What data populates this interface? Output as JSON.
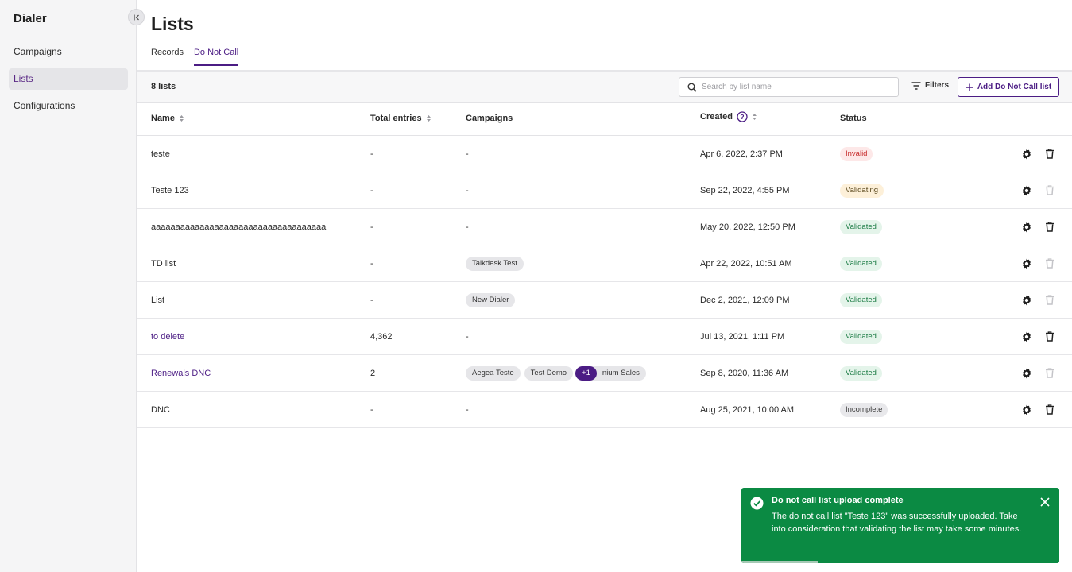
{
  "app": {
    "title": "Dialer"
  },
  "sidebar": {
    "items": [
      {
        "label": "Campaigns",
        "active": false
      },
      {
        "label": "Lists",
        "active": true
      },
      {
        "label": "Configurations",
        "active": false
      }
    ]
  },
  "page": {
    "title": "Lists"
  },
  "tabs": [
    {
      "label": "Records",
      "active": false
    },
    {
      "label": "Do Not Call",
      "active": true
    }
  ],
  "toolbar": {
    "count": "8 lists",
    "search_placeholder": "Search by list name",
    "filters_label": "Filters",
    "add_label": "Add Do Not Call list"
  },
  "table": {
    "headers": {
      "name": "Name",
      "total": "Total entries",
      "campaigns": "Campaigns",
      "created": "Created",
      "status": "Status"
    },
    "rows": [
      {
        "name": "teste",
        "link": false,
        "total": "-",
        "campaigns": [],
        "campaigns_text": "-",
        "created": "Apr 6, 2022, 2:37 PM",
        "status": "Invalid",
        "delete_enabled": true
      },
      {
        "name": "Teste 123",
        "link": false,
        "total": "-",
        "campaigns": [],
        "campaigns_text": "-",
        "created": "Sep 22, 2022, 4:55 PM",
        "status": "Validating",
        "delete_enabled": false
      },
      {
        "name": "aaaaaaaaaaaaaaaaaaaaaaaaaaaaaaaaaaaa",
        "link": false,
        "total": "-",
        "campaigns": [],
        "campaigns_text": "-",
        "created": "May 20, 2022, 12:50 PM",
        "status": "Validated",
        "delete_enabled": true
      },
      {
        "name": "TD list",
        "link": false,
        "total": "-",
        "campaigns": [
          "Talkdesk Test"
        ],
        "campaigns_text": "",
        "created": "Apr 22, 2022, 10:51 AM",
        "status": "Validated",
        "delete_enabled": false
      },
      {
        "name": "List",
        "link": false,
        "total": "-",
        "campaigns": [
          "New Dialer"
        ],
        "campaigns_text": "",
        "created": "Dec 2, 2021, 12:09 PM",
        "status": "Validated",
        "delete_enabled": false
      },
      {
        "name": "to delete",
        "link": true,
        "total": "4,362",
        "campaigns": [],
        "campaigns_text": "-",
        "created": "Jul 13, 2021, 1:11 PM",
        "status": "Validated",
        "delete_enabled": true
      },
      {
        "name": "Renewals DNC",
        "link": true,
        "total": "2",
        "campaigns": [
          "Aegea Teste",
          "Test Demo"
        ],
        "campaigns_more": "+1",
        "campaigns_partial": "nium Sales",
        "campaigns_text": "",
        "created": "Sep 8, 2020, 11:36 AM",
        "status": "Validated",
        "delete_enabled": false
      },
      {
        "name": "DNC",
        "link": false,
        "total": "-",
        "campaigns": [],
        "campaigns_text": "-",
        "created": "Aug 25, 2021, 10:00 AM",
        "status": "Incomplete",
        "delete_enabled": true
      }
    ]
  },
  "status_colors": {
    "Invalid": {
      "bg": "#fde8e8",
      "fg": "#c62828"
    },
    "Validating": {
      "bg": "#fdf0d9",
      "fg": "#5c4a1f"
    },
    "Validated": {
      "bg": "#e4f4ea",
      "fg": "#1a7a43"
    },
    "Incomplete": {
      "bg": "#e8e8eb",
      "fg": "#3a3a3a"
    }
  },
  "toast": {
    "title": "Do not call list upload complete",
    "message": "The do not call list \"Teste 123\" was successfully uploaded. Take into consideration that validating the list may take some minutes.",
    "progress": 0.24
  },
  "colors": {
    "accent": "#4b1c84",
    "toast": "#0b8a43"
  }
}
